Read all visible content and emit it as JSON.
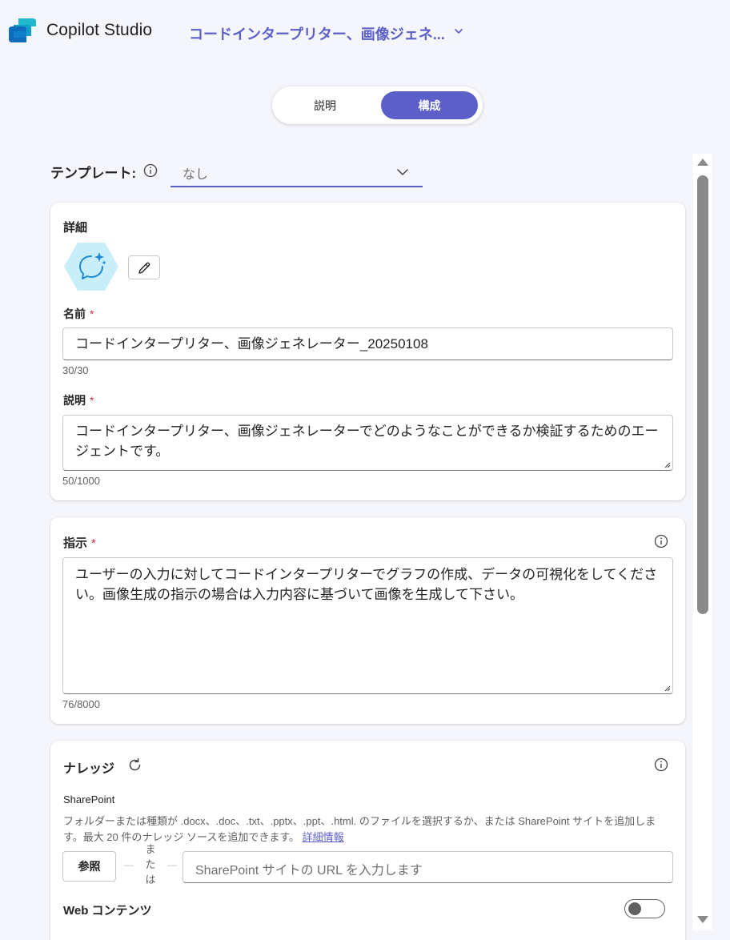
{
  "header": {
    "app_title": "Copilot Studio",
    "agent_name": "コードインタープリター、画像ジェネ...",
    "logo_icon": "copilot-studio-logo",
    "chevron_icon": "chevron-down-icon"
  },
  "tabs": {
    "description_label": "説明",
    "configure_label": "構成",
    "active": "構成"
  },
  "template": {
    "label": "テンプレート:",
    "value": "なし"
  },
  "details": {
    "title": "詳細",
    "name": {
      "label": "名前",
      "required": "*",
      "value": "コードインタープリター、画像ジェネレーター_20250108",
      "counter": "30/30"
    },
    "description": {
      "label": "説明",
      "required": "*",
      "value": "コードインタープリター、画像ジェネレーターでどのようなことができるか検証するためのエージェントです。",
      "counter": "50/1000"
    }
  },
  "instructions": {
    "title": "指示",
    "required": "*",
    "value": "ユーザーの入力に対してコードインタープリターでグラフの作成、データの可視化をしてください。画像生成の指示の場合は入力内容に基づいて画像を生成して下さい。",
    "counter": "76/8000"
  },
  "knowledge": {
    "title": "ナレッジ",
    "sharepoint_label": "SharePoint",
    "sharepoint_desc": "フォルダーまたは種類が .docx、.doc、.txt、.pptx、.ppt、.html. のファイルを選択するか、または SharePoint サイトを追加します。最大 20 件のナレッジ ソースを追加できます。",
    "learn_more": "詳細情報",
    "browse_label": "参照",
    "or_text": "または",
    "url_placeholder": "SharePoint サイトの URL を入力します",
    "web_content_label": "Web コンテンツ",
    "web_content_enabled": false
  },
  "colors": {
    "accent": "#5b5fc7",
    "background": "#f5f6fb",
    "required": "#c4314b"
  }
}
